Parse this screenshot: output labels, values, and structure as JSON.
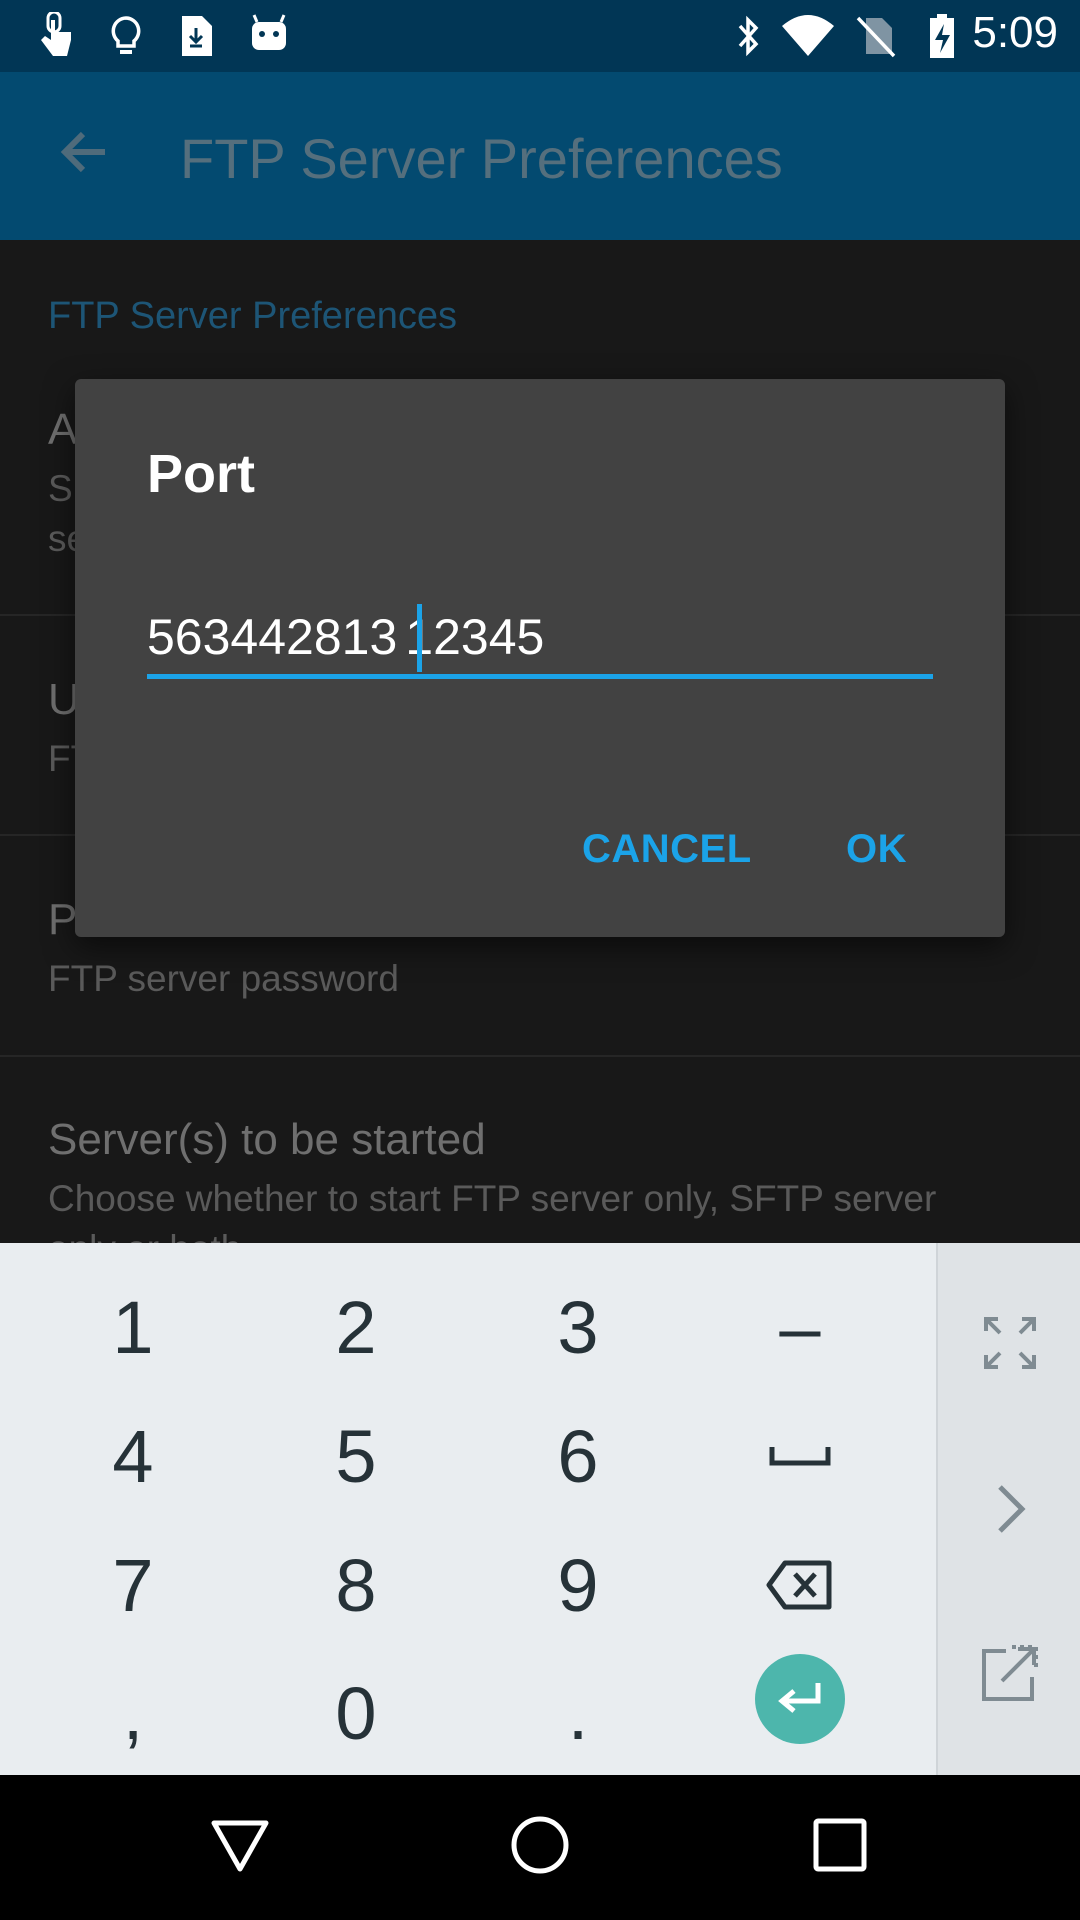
{
  "status_bar": {
    "time": "5:09",
    "left_icons": [
      "touch-icon",
      "lightbulb-icon",
      "file-download-icon",
      "android-icon"
    ],
    "right_icons": [
      "bluetooth-icon",
      "wifi-icon",
      "no-sim-icon",
      "battery-charging-icon"
    ]
  },
  "toolbar": {
    "title": "FTP Server Preferences",
    "back_icon": "back-arrow-icon"
  },
  "preferences": {
    "category": "FTP Server Preferences",
    "items": [
      {
        "title": "A",
        "summary_line1": "S",
        "summary_line2": "se"
      },
      {
        "title": "U",
        "summary_line1": "FT"
      },
      {
        "title": "Password",
        "summary": "FTP server password"
      },
      {
        "title": "Server(s) to be started",
        "summary": "Choose whether to start FTP server only, SFTP server",
        "summary_line2": "only or both"
      }
    ]
  },
  "dialog": {
    "title": "Port",
    "input_value": "563442813|12345",
    "input_text_before_cursor": "563442813",
    "input_text_after_cursor": "12345",
    "cancel_label": "CANCEL",
    "ok_label": "OK",
    "accent_color": "#1ba3e8"
  },
  "keyboard": {
    "rows": [
      [
        "1",
        "2",
        "3",
        "–"
      ],
      [
        "4",
        "5",
        "6",
        "␣"
      ],
      [
        "7",
        "8",
        "9",
        "⌫"
      ],
      [
        ",",
        "0",
        ".",
        "↵"
      ]
    ],
    "side_icons": [
      "fullscreen-icon",
      "chevron-right-icon",
      "open-external-icon"
    ],
    "enter_color": "#4db6ac"
  },
  "nav_bar": {
    "icons": [
      "back-triangle-icon",
      "home-circle-icon",
      "recents-square-icon"
    ]
  }
}
